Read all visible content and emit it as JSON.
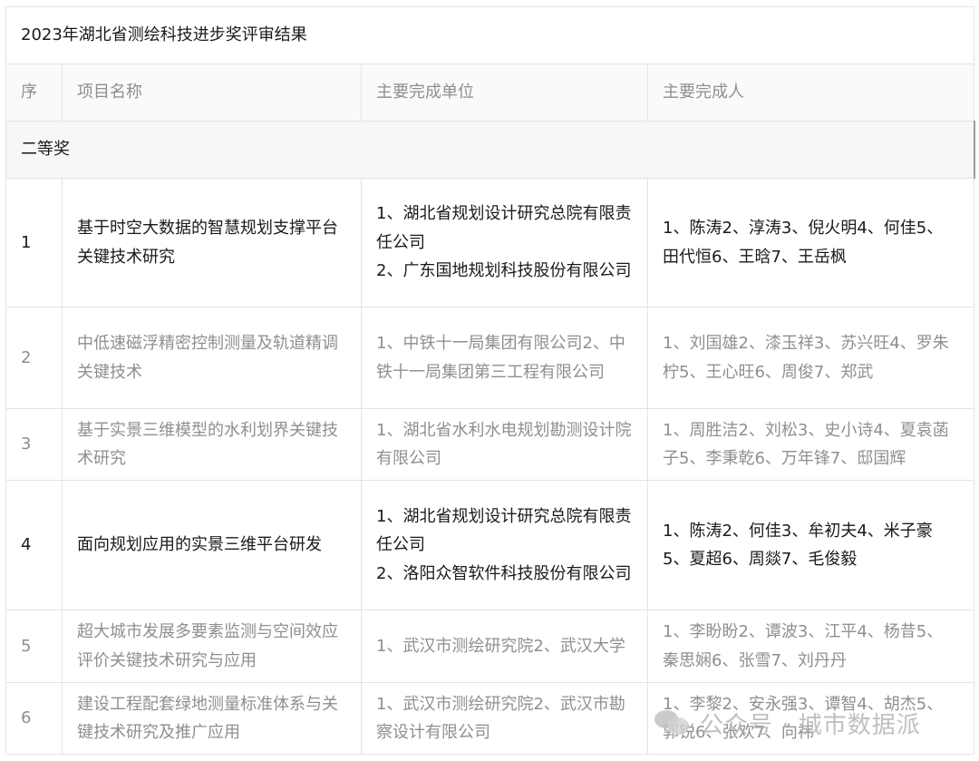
{
  "title": "2023年湖北省测绘科技进步奖评审结果",
  "headers": [
    "序",
    "项目名称",
    "主要完成单位",
    "主要完成人"
  ],
  "section": "二等奖",
  "rows": [
    {
      "index": "1",
      "name": "基于时空大数据的智慧规划支撑平台关键技术研究",
      "units": "1、湖北省规划设计研究总院有限责任公司\n2、广东国地规划科技股份有限公司",
      "people": "1、陈涛2、淳涛3、倪火明4、何佳5、田代恒6、王晗7、王岳枫"
    },
    {
      "index": "2",
      "name": "中低速磁浮精密控制测量及轨道精调关键技术",
      "units": "1、中铁十一局集团有限公司2、中铁十一局集团第三工程有限公司",
      "people": "1、刘国雄2、漆玉祥3、苏兴旺4、罗朱柠5、王心旺6、周俊7、郑武"
    },
    {
      "index": "3",
      "name": "基于实景三维模型的水利划界关键技术研究",
      "units": "1、湖北省水利水电规划勘测设计院有限公司",
      "people": "1、周胜洁2、刘松3、史小诗4、夏袁菡子5、李秉乾6、万年锋7、邸国辉"
    },
    {
      "index": "4",
      "name": "面向规划应用的实景三维平台研发",
      "units": "1、湖北省规划设计研究总院有限责任公司\n2、洛阳众智软件科技股份有限公司",
      "people": "1、陈涛2、何佳3、牟初夫4、米子豪5、夏超6、周燚7、毛俊毅"
    },
    {
      "index": "5",
      "name": "超大城市发展多要素监测与空间效应评价关键技术研究与应用",
      "units": "1、武汉市测绘研究院2、武汉大学",
      "people": "1、李盼盼2、谭波3、江平4、杨昔5、秦思娴6、张雪7、刘丹丹"
    },
    {
      "index": "6",
      "name": "建设工程配套绿地测量标准体系与关键技术研究及推广应用",
      "units": "1、武汉市测绘研究院2、武汉市勘察设计有限公司",
      "people": "1、李黎2、安永强3、谭智4、胡杰5、郭锐6、张欢7、向祎"
    }
  ],
  "watermark": "公众号 · 城市数据派",
  "colors": {
    "dark_text": "#1a1a1a",
    "gray_text": "#8f8f8f",
    "border": "#e3e3e3"
  }
}
